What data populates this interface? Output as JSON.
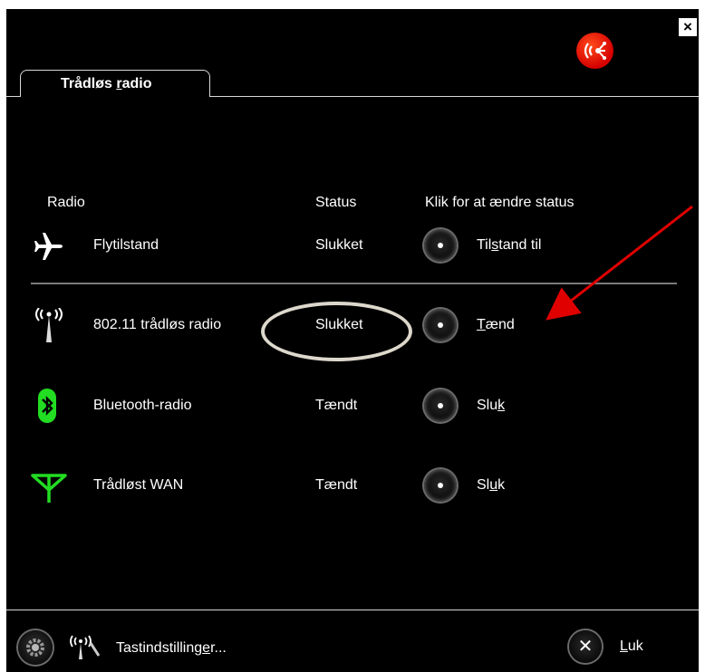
{
  "window": {
    "close_glyph": "×",
    "logo_icon": "wireless-broadcast-icon"
  },
  "tab": {
    "label_pre": "Trådløs ",
    "label_key": "r",
    "label_post": "adio"
  },
  "headers": {
    "radio": "Radio",
    "status": "Status",
    "action": "Klik for at ændre status"
  },
  "rows": [
    {
      "icon": "airplane-icon",
      "name": "Flytilstand",
      "status": "Slukket",
      "action_pre": "Til",
      "action_key": "s",
      "action_post": "tand til"
    },
    {
      "icon": "antenna-icon",
      "name": "802.11 trådløs radio",
      "status": "Slukket",
      "action_pre": "",
      "action_key": "T",
      "action_post": "ænd"
    },
    {
      "icon": "bluetooth-icon",
      "name": "Bluetooth-radio",
      "status": "Tændt",
      "action_pre": "Slu",
      "action_key": "k",
      "action_post": ""
    },
    {
      "icon": "wan-antenna-icon",
      "name": "Trådløst WAN",
      "status": "Tændt",
      "action_pre": "Sl",
      "action_key": "u",
      "action_post": "k"
    }
  ],
  "footer": {
    "settings_pre": "Tastindstilling",
    "settings_key": "e",
    "settings_post": "r...",
    "close_glyph": "✕",
    "close_key": "L",
    "close_post": "uk"
  },
  "colors": {
    "background": "#000000",
    "text": "#ffffff",
    "bluetooth": "#22dd22",
    "wan": "#22dd22",
    "annotation_arrow": "#e00000",
    "annotation_circle": "#ddd8cc"
  }
}
